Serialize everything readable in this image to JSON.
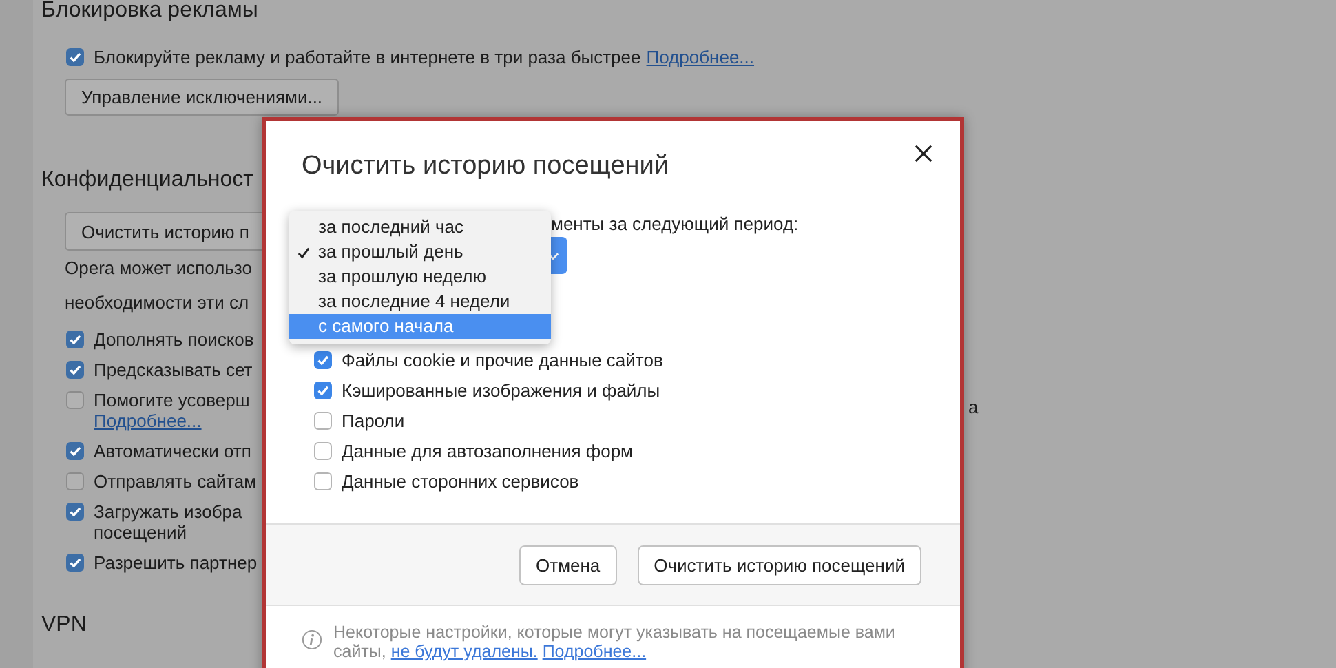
{
  "background": {
    "sections": [
      {
        "heading": "Блокировка рекламы",
        "items": [
          {
            "kind": "checkbox",
            "label": "Блокируйте рекламу и работайте в интернете в три раза быстрее",
            "link": "Подробнее...",
            "checked": true
          },
          {
            "kind": "button",
            "label": "Управление исключениями..."
          }
        ]
      },
      {
        "heading": "Конфиденциальност",
        "items": [
          {
            "kind": "button",
            "label": "Очистить историю п"
          },
          {
            "kind": "text",
            "label": "Opera может использо"
          },
          {
            "kind": "text",
            "label": "необходимости эти сл"
          },
          {
            "kind": "checkbox",
            "label": "Дополнять поисков",
            "checked": true
          },
          {
            "kind": "checkbox",
            "label": "Предсказывать сет",
            "checked": true
          },
          {
            "kind": "checkbox",
            "label": "Помогите усоверш",
            "link": "Подробнее...",
            "checked": false
          },
          {
            "kind": "checkbox",
            "label": "Автоматически отп",
            "checked": true
          },
          {
            "kind": "checkbox",
            "label": "Отправлять сайтам",
            "checked": false
          },
          {
            "kind": "checkbox",
            "label": "Загружать изобра",
            "line2": "посещений",
            "checked": true
          },
          {
            "kind": "checkbox",
            "label": "Разрешить партнер",
            "checked": true
          }
        ]
      },
      {
        "heading": "VPN"
      }
    ],
    "fragment": "а"
  },
  "dialog": {
    "title": "Очистить историю посещений",
    "prompt": "менты за следующий период:",
    "period_menu": [
      {
        "label": "за последний час",
        "checked": false,
        "highlighted": false
      },
      {
        "label": "за прошлый день",
        "checked": true,
        "highlighted": false
      },
      {
        "label": "за прошлую неделю",
        "checked": false,
        "highlighted": false
      },
      {
        "label": "за последние 4 недели",
        "checked": false,
        "highlighted": false
      },
      {
        "label": "с самого начала",
        "checked": false,
        "highlighted": true
      }
    ],
    "items": [
      {
        "label": "Файлы cookie и прочие данные сайтов",
        "checked": true
      },
      {
        "label": "Кэшированные изображения и файлы",
        "checked": true
      },
      {
        "label": "Пароли",
        "checked": false
      },
      {
        "label": "Данные для автозаполнения форм",
        "checked": false
      },
      {
        "label": "Данные сторонних сервисов",
        "checked": false
      }
    ],
    "buttons": [
      "Отмена",
      "Очистить историю посещений"
    ],
    "note": {
      "text": "Некоторые настройки, которые могут указывать на посещаемые вами сайты,",
      "links": [
        "не будут удалены.",
        "Подробнее..."
      ]
    }
  }
}
